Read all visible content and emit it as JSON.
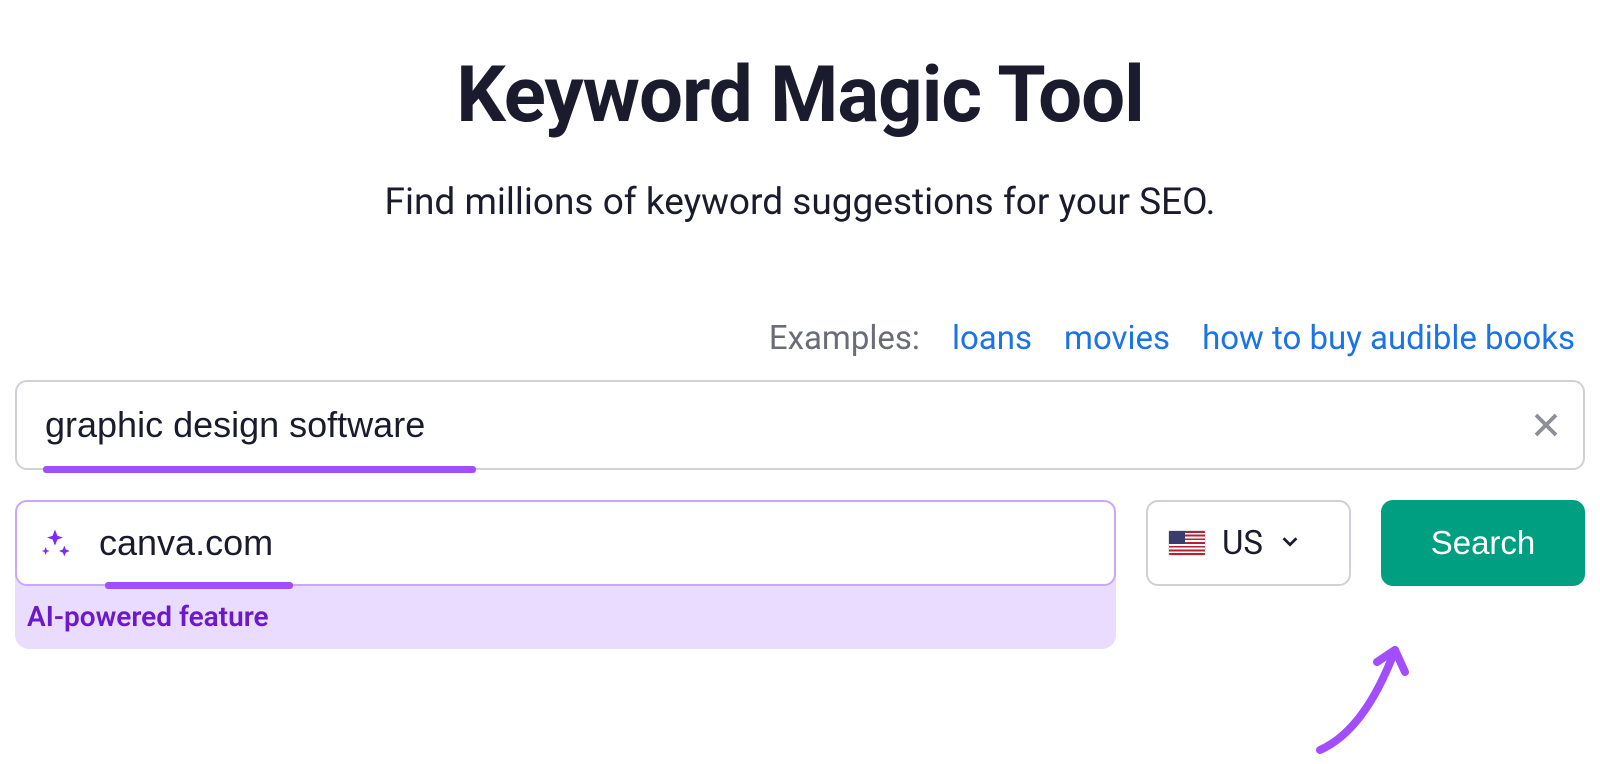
{
  "header": {
    "title": "Keyword Magic Tool",
    "subtitle": "Find millions of keyword suggestions for your SEO."
  },
  "examples": {
    "label": "Examples:",
    "items": [
      "loans",
      "movies",
      "how to buy audible books"
    ]
  },
  "search": {
    "keyword_value": "graphic design software",
    "domain_value": "canva.com",
    "ai_feature_label": "AI-powered feature",
    "country_code": "US",
    "search_button_label": "Search"
  }
}
